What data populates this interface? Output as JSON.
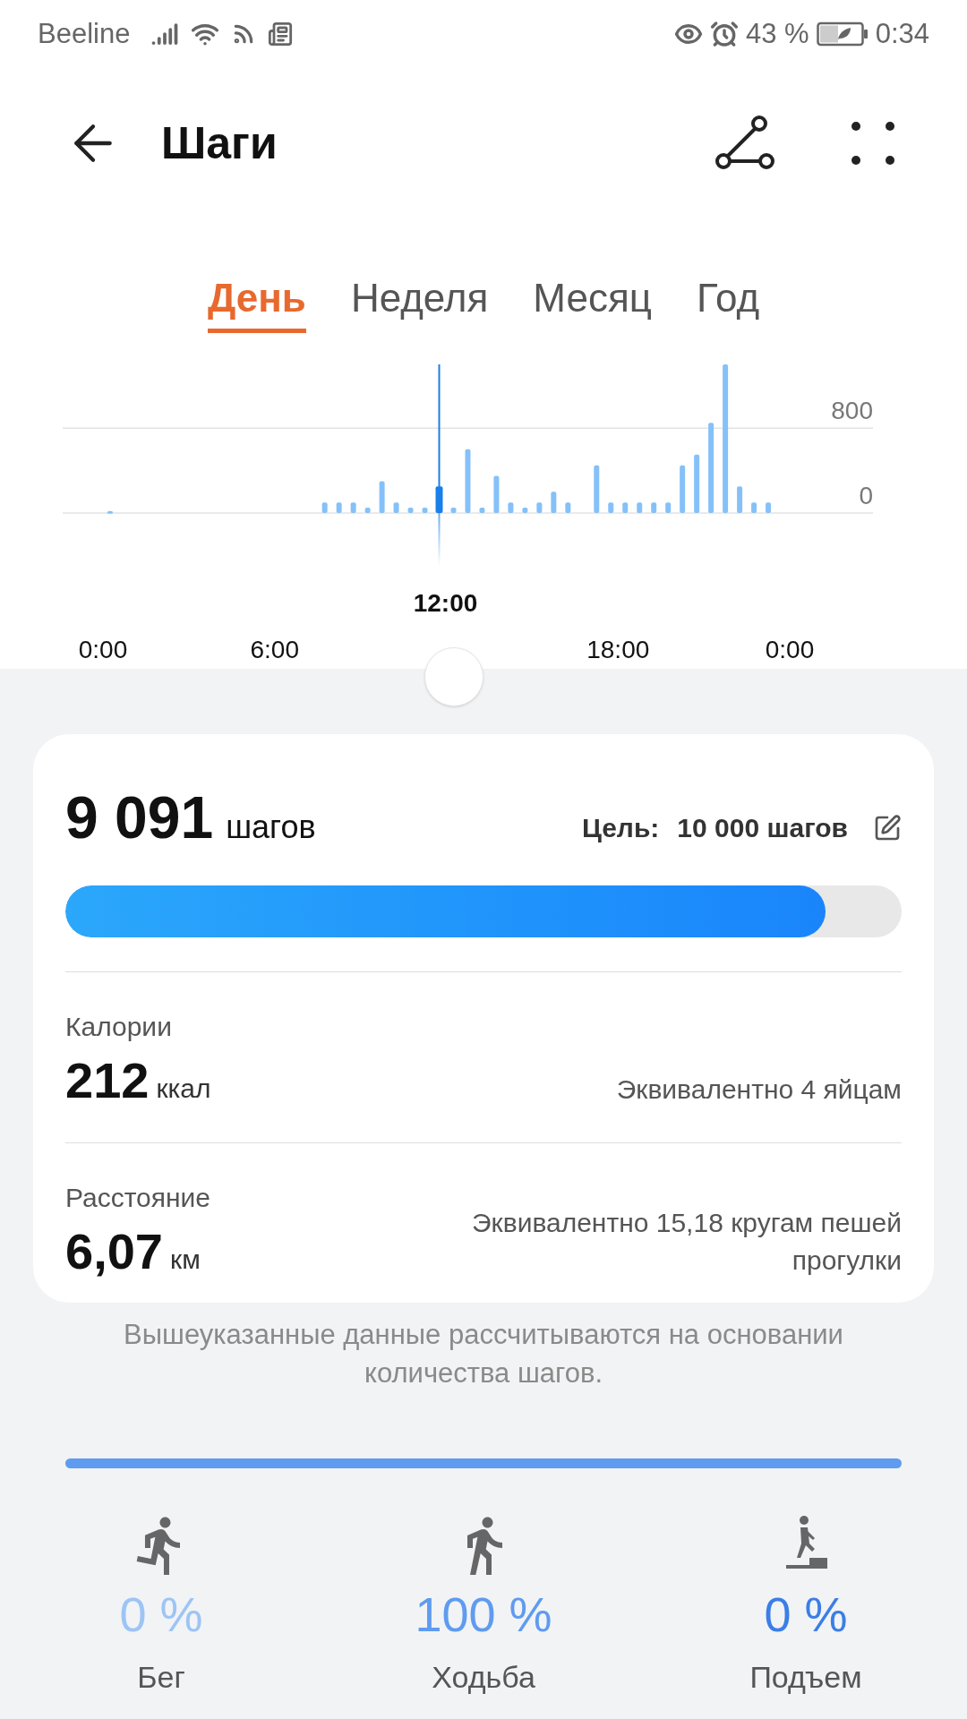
{
  "status_bar": {
    "carrier": "Beeline",
    "battery_percent": "43 %",
    "time": "0:34"
  },
  "header": {
    "title": "Шаги"
  },
  "tabs": [
    {
      "label": "День",
      "selected": true
    },
    {
      "label": "Неделя",
      "selected": false
    },
    {
      "label": "Месяц",
      "selected": false
    },
    {
      "label": "Год",
      "selected": false
    }
  ],
  "chart_data": {
    "type": "bar",
    "x": [
      0.25,
      0.75,
      1.25,
      1.75,
      2.25,
      2.75,
      3.25,
      3.75,
      4.25,
      4.75,
      5.25,
      5.75,
      6.25,
      6.75,
      7.25,
      7.75,
      8.25,
      8.75,
      9.25,
      9.75,
      10.25,
      10.75,
      11.25,
      11.75,
      12.25,
      12.75,
      13.25,
      13.75,
      14.25,
      14.75,
      15.25,
      15.75,
      16.25,
      16.75,
      17.25,
      17.75,
      18.25,
      18.75,
      19.25,
      19.75,
      20.25,
      20.75,
      21.25,
      21.75,
      22.25,
      22.75,
      23.25
    ],
    "series": [
      {
        "color": "#85c1f8",
        "values": [
          20,
          null,
          null,
          null,
          null,
          null,
          null,
          null,
          null,
          null,
          null,
          null,
          null,
          null,
          null,
          100,
          100,
          100,
          50,
          300,
          100,
          50,
          50,
          null,
          50,
          600,
          50,
          350,
          100,
          50,
          100,
          200,
          100,
          null,
          450,
          100,
          100,
          100,
          100,
          100,
          450,
          550,
          850,
          1400,
          250,
          100,
          100
        ]
      },
      {
        "color": "#1a7fe8",
        "values": [
          null,
          null,
          null,
          null,
          null,
          null,
          null,
          null,
          null,
          null,
          null,
          null,
          null,
          null,
          null,
          null,
          null,
          null,
          null,
          null,
          null,
          null,
          null,
          250,
          null,
          null,
          null,
          null,
          null,
          null,
          null,
          null,
          null,
          null,
          null,
          null,
          null,
          null,
          null,
          null,
          null,
          null,
          null,
          null,
          null,
          null,
          null
        ]
      }
    ],
    "xlim": [
      0,
      24
    ],
    "ylim": [
      0,
      1400
    ],
    "yticks": [
      0,
      800
    ],
    "xticks": [
      {
        "value": 0,
        "label": "0:00"
      },
      {
        "value": 6,
        "label": "6:00"
      },
      {
        "value": 18,
        "label": "18:00"
      },
      {
        "value": 24,
        "label": "0:00"
      }
    ],
    "ref_lines": [
      {
        "axis": "x",
        "value": 11.75
      }
    ],
    "annotations": [
      "12:00"
    ]
  },
  "summary": {
    "steps": "9 091",
    "steps_unit": "шагов",
    "goal_label": "Цель:",
    "goal_value": "10 000 шагов",
    "level": 0.9091
  },
  "metrics": [
    {
      "label": "Калории",
      "value": "212",
      "unit": "ккал",
      "equivalent": "Эквивалентно 4 яйцам"
    },
    {
      "label": "Расстояние",
      "value": "6,07",
      "unit": "км",
      "equivalent": "Эквивалентно 15,18 кругам пешей прогулки"
    }
  ],
  "footnote": "Вышеуказанные данные рассчитываются на основании количества шагов.",
  "activities": [
    {
      "kind": "run",
      "percent": "0 %",
      "label": "Бег",
      "color": "#9dc4f5"
    },
    {
      "kind": "walk",
      "percent": "100 %",
      "label": "Ходьба",
      "color": "#5f9bef"
    },
    {
      "kind": "climb",
      "percent": "0 %",
      "label": "Подъем",
      "color": "#3b7ee6"
    }
  ]
}
